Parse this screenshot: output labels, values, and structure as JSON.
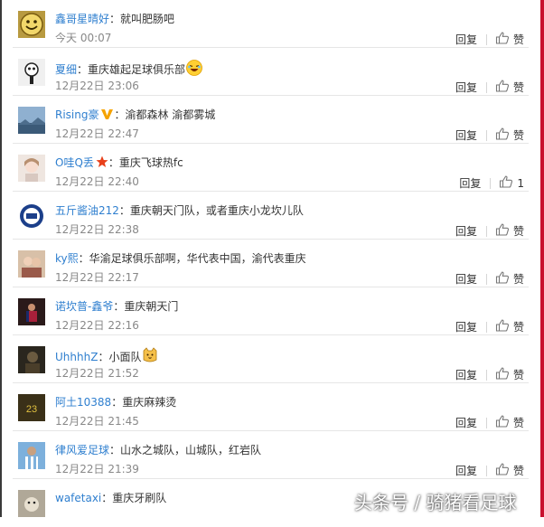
{
  "comments": [
    {
      "name": "鑫哥星晴好",
      "text": "就叫肥肠吧",
      "time": "今天 00:07",
      "reply": "回复",
      "like": "赞",
      "avatar": "face-icon",
      "color": "#c9a850"
    },
    {
      "name": "夏细",
      "text": "重庆雄起足球俱乐部",
      "time": "12月22日 23:06",
      "reply": "回复",
      "like": "赞",
      "avatar": "cartoon-icon",
      "color": "#dcdcdc",
      "emoji": "laugh-emoji-icon"
    },
    {
      "name": "Rising豪",
      "text": "渝都森林 渝都雾城",
      "time": "12月22日 22:47",
      "reply": "回复",
      "like": "赞",
      "avatar": "landscape-icon",
      "color": "#6e8fb0",
      "badge": "v-badge-icon"
    },
    {
      "name": "O哇Q丢",
      "text": "重庆飞球热fc",
      "time": "12月22日 22:40",
      "reply": "回复",
      "like": "1",
      "avatar": "girl-icon",
      "color": "#e8dcd4",
      "badge": "star-badge-icon"
    },
    {
      "name": "五斤酱油212",
      "text": "重庆朝天门队，或者重庆小龙坎儿队",
      "time": "12月22日 22:38",
      "reply": "回复",
      "like": "赞",
      "avatar": "chelsea-badge-icon",
      "color": "#1c3f8a"
    },
    {
      "name": "ky熙",
      "text": "华渝足球俱乐部啊，华代表中国，渝代表重庆",
      "time": "12月22日 22:17",
      "reply": "回复",
      "like": "赞",
      "avatar": "people-icon",
      "color": "#b8917a"
    },
    {
      "name": "诺坎普-鑫爷",
      "text": "重庆朝天门",
      "time": "12月22日 22:16",
      "reply": "回复",
      "like": "赞",
      "avatar": "player-icon",
      "color": "#6a2a2a"
    },
    {
      "name": "UhhhhZ",
      "text": "小面队",
      "time": "12月22日 21:52",
      "reply": "回复",
      "like": "赞",
      "avatar": "dark-portrait-icon",
      "color": "#3a3428",
      "emoji": "cat-emoji-icon"
    },
    {
      "name": "阿土10388",
      "text": "重庆麻辣烫",
      "time": "12月22日 21:45",
      "reply": "回复",
      "like": "赞",
      "avatar": "jersey-icon",
      "color": "#4a4020"
    },
    {
      "name": "律风爱足球",
      "text": "山水之城队，山城队，红岩队",
      "time": "12月22日 21:39",
      "reply": "回复",
      "like": "赞",
      "avatar": "messi-icon",
      "color": "#6fa7d8"
    },
    {
      "name": "wafetaxi",
      "text": "重庆牙刷队",
      "time": "",
      "reply": "",
      "like": "",
      "avatar": "dog-icon",
      "color": "#a0a0a0"
    }
  ],
  "colon": "：",
  "watermark": "头条号 / 骑猪看足球",
  "colors": {
    "name": "#2f7fcf",
    "time": "#888888",
    "divider": "#e6e6e6"
  }
}
